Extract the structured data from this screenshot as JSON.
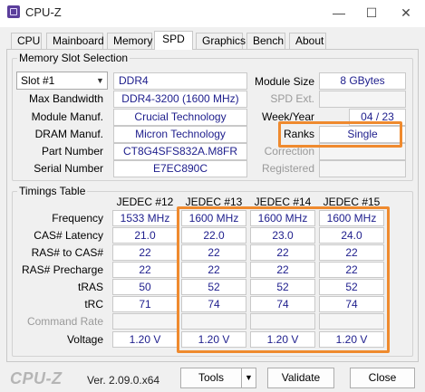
{
  "window": {
    "title": "CPU-Z",
    "minimize_glyph": "—",
    "maximize_glyph": "☐",
    "close_glyph": "✕"
  },
  "tabs": [
    {
      "label": "CPU"
    },
    {
      "label": "Mainboard"
    },
    {
      "label": "Memory"
    },
    {
      "label": "SPD"
    },
    {
      "label": "Graphics"
    },
    {
      "label": "Bench"
    },
    {
      "label": "About"
    }
  ],
  "active_tab": "SPD",
  "slot_group": {
    "title": "Memory Slot Selection",
    "slot_value": "Slot #1",
    "memory_type": "DDR4",
    "labels": {
      "max_bandwidth": "Max Bandwidth",
      "module_manuf": "Module Manuf.",
      "dram_manuf": "DRAM Manuf.",
      "part_number": "Part Number",
      "serial_number": "Serial Number",
      "module_size": "Module Size",
      "spd_ext": "SPD Ext.",
      "week_year": "Week/Year",
      "ranks": "Ranks",
      "correction": "Correction",
      "registered": "Registered"
    },
    "values": {
      "max_bandwidth": "DDR4-3200 (1600 MHz)",
      "module_manuf": "Crucial Technology",
      "dram_manuf": "Micron Technology",
      "part_number": "CT8G4SFS832A.M8FR",
      "serial_number": "E7EC890C",
      "module_size": "8 GBytes",
      "week_year": "04 / 23",
      "ranks": "Single"
    }
  },
  "timings": {
    "title": "Timings Table",
    "columns": [
      "JEDEC #12",
      "JEDEC #13",
      "JEDEC #14",
      "JEDEC #15"
    ],
    "row_labels": [
      "Frequency",
      "CAS# Latency",
      "RAS# to CAS#",
      "RAS# Precharge",
      "tRAS",
      "tRC",
      "Command Rate",
      "Voltage"
    ],
    "rows": [
      [
        "1533 MHz",
        "1600 MHz",
        "1600 MHz",
        "1600 MHz"
      ],
      [
        "21.0",
        "22.0",
        "23.0",
        "24.0"
      ],
      [
        "22",
        "22",
        "22",
        "22"
      ],
      [
        "22",
        "22",
        "22",
        "22"
      ],
      [
        "50",
        "52",
        "52",
        "52"
      ],
      [
        "71",
        "74",
        "74",
        "74"
      ],
      [
        "",
        "",
        "",
        ""
      ],
      [
        "1.20 V",
        "1.20 V",
        "1.20 V",
        "1.20 V"
      ]
    ]
  },
  "footer": {
    "logo": "CPU-Z",
    "version": "Ver. 2.09.0.x64",
    "tools_label": "Tools",
    "validate_label": "Validate",
    "close_label": "Close"
  },
  "colors": {
    "value_text": "#1d1d8c",
    "highlight": "#ef8a2e",
    "logo": "#b5b5b5"
  },
  "icons": [
    "app-icon",
    "minimize-icon",
    "maximize-icon",
    "close-icon",
    "dropdown-arrow-icon"
  ]
}
